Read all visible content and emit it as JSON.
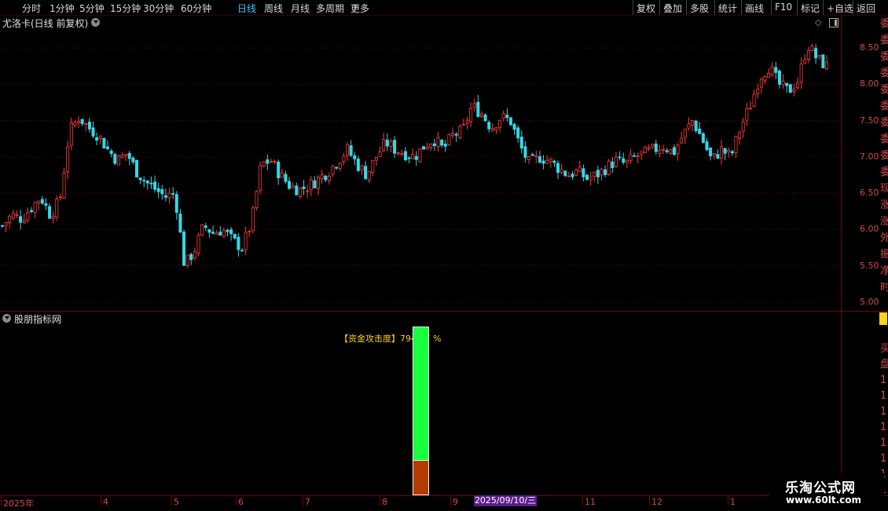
{
  "toolbar": {
    "periods": [
      "分时",
      "1分钟",
      "5分钟",
      "15分钟",
      "30分钟",
      "60分钟",
      "日线",
      "周线",
      "月线",
      "多周期",
      "更多"
    ],
    "active_period": "日线",
    "more_arrow": "›",
    "right_buttons": [
      "复权",
      "叠加",
      "多股",
      "统计",
      "画线",
      "F10",
      "标记",
      "+自选",
      "返回"
    ]
  },
  "main": {
    "title": "尤洛卡(日线 前复权)",
    "y_ticks": [
      "8.50",
      "8.00",
      "7.50",
      "7.00",
      "6.50",
      "6.00",
      "5.50",
      "5.00"
    ]
  },
  "indicator": {
    "title": "股朋指标网",
    "label": "【资金攻击度】794.57 %",
    "value_percent": 794.57
  },
  "date_axis": {
    "labels": [
      "2025年",
      "4",
      "5",
      "6",
      "7",
      "8",
      "9",
      "11",
      "12",
      "1"
    ],
    "cursor_date": "2025/09/10/三"
  },
  "right_strip": {
    "chars": [
      "委",
      "委",
      "委",
      "委",
      "委",
      "委",
      "委",
      "委",
      "委",
      "委",
      "现",
      "涨",
      "涨",
      "外",
      "振",
      "净",
      "时"
    ],
    "lower_chars": [
      "日",
      "买",
      "盘",
      "1",
      "1",
      "1",
      "1",
      "1",
      "1",
      "1",
      "1",
      "1"
    ]
  },
  "watermark": {
    "line1": "乐淘公式网",
    "line2": "www.60lt.com"
  },
  "colors": {
    "up": "#ff3c3c",
    "down": "#37d7e6",
    "active_tab": "#39c6ff",
    "grid": "#7a0000",
    "indicator_top": "#1aff3d",
    "indicator_bottom": "#b43c00",
    "label": "#ffd21a"
  },
  "chart_data": {
    "type": "candlestick",
    "ylim": [
      4.9,
      8.75
    ],
    "y_ticks": [
      8.5,
      8.0,
      7.5,
      7.0,
      6.5,
      6.0,
      5.5,
      5.0
    ],
    "path": [
      6.05,
      6.2,
      6.15,
      6.3,
      6.45,
      6.2,
      6.4,
      7.35,
      7.55,
      7.4,
      7.3,
      7.1,
      6.95,
      7.05,
      6.8,
      6.65,
      6.55,
      6.45,
      6.5,
      5.5,
      5.7,
      6.05,
      5.95,
      6.0,
      5.85,
      5.75,
      6.1,
      6.9,
      6.95,
      6.75,
      6.6,
      6.55,
      6.6,
      6.7,
      6.8,
      6.95,
      7.1,
      6.9,
      6.75,
      7.0,
      7.2,
      7.1,
      7.05,
      7.0,
      7.15,
      7.25,
      7.1,
      7.3,
      7.35,
      7.7,
      7.6,
      7.4,
      7.55,
      7.5,
      7.15,
      6.9,
      7.0,
      6.95,
      6.85,
      6.75,
      6.8,
      6.7,
      6.75,
      6.85,
      6.95,
      6.9,
      7.0,
      7.05,
      7.1,
      7.15,
      7.05,
      7.3,
      7.5,
      7.25,
      6.95,
      7.1,
      7.0,
      7.4,
      7.7,
      8.1,
      8.25,
      8.0,
      7.9,
      8.05,
      8.55,
      8.35,
      8.25
    ]
  }
}
